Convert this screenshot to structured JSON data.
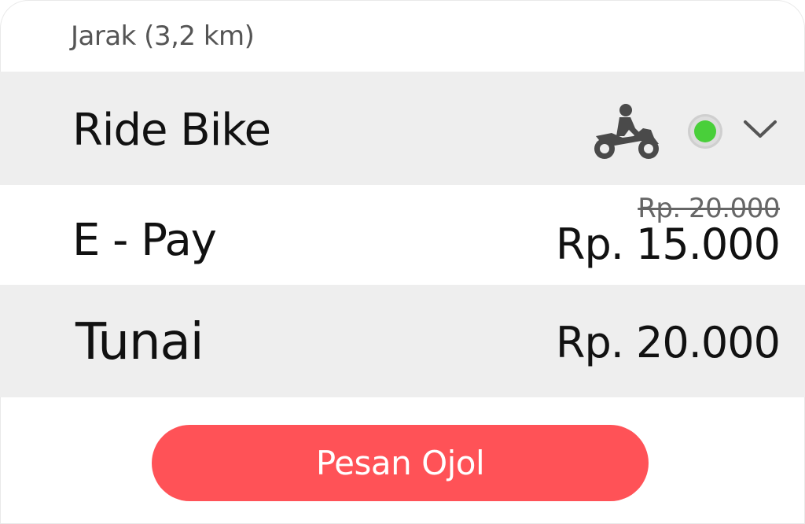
{
  "distance_label": "Jarak (3,2 km)",
  "service": {
    "label": "Ride Bike",
    "vehicle_icon": "motorbike-icon",
    "status_color": "#49cf3a",
    "dropdown_icon": "chevron-down-icon"
  },
  "payments": {
    "epay": {
      "label": "E - Pay",
      "original_price": "Rp. 20.000",
      "price": "Rp. 15.000"
    },
    "tunai": {
      "label": "Tunai",
      "price": "Rp. 20.000"
    }
  },
  "order_button": {
    "label": "Pesan Ojol",
    "color": "#ff5257"
  }
}
